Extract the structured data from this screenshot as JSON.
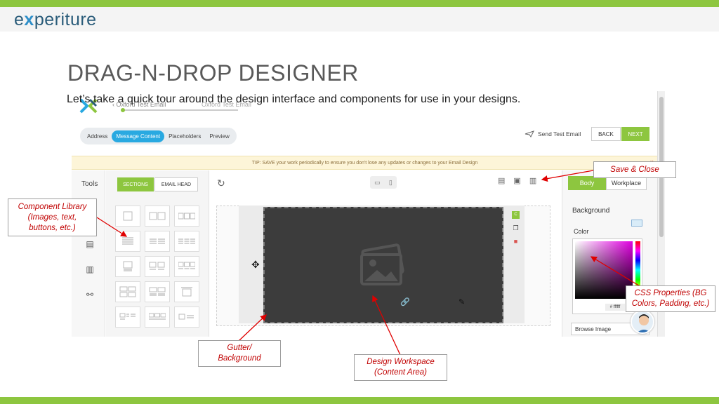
{
  "brand": {
    "logo_prefix": "e",
    "logo_x": "x",
    "logo_suffix": "periture",
    "accent": "#8dc63f",
    "blue": "#29a9e1"
  },
  "slide": {
    "title": "DRAG-N-DROP DESIGNER",
    "subtitle": "Let’s take a quick tour around the design interface and components for use in your designs."
  },
  "app": {
    "doc_name": "Oxford Test Email",
    "doc_name_secondary": "Oxford Test Email",
    "step_tabs": [
      "Address",
      "Message Content",
      "Placeholders",
      "Preview"
    ],
    "active_step": "Message Content",
    "send_test": "Send Test Email",
    "back": "BACK",
    "next": "NEXT",
    "tip": "TIP: SAVE your work periodically to ensure you don't lose any updates or changes to your Email Design",
    "tip_close": "×",
    "tools_label": "Tools",
    "lib_tabs": {
      "sections": "SECTIONS",
      "email_head": "EMAIL HEAD"
    },
    "props_tabs": {
      "body": "Body",
      "workplace": "Workplace"
    },
    "background_label": "Background",
    "color_label": "Color",
    "hex_placeholder": "# ffffff",
    "browse_image": "Browse Image"
  },
  "callouts": {
    "save_close": "Save & Close",
    "component_library": "Component Library (Images, text, buttons, etc.)",
    "css_properties": "CSS Properties (BG Colors, Padding, etc.)",
    "gutter": "Gutter/ Background",
    "design_workspace": "Design Workspace (Content Area)"
  },
  "icons": [
    "refresh-icon",
    "desktop-icon",
    "mobile-icon",
    "save-icon",
    "move-icon",
    "link-icon",
    "edit-icon",
    "delete-icon",
    "copy-icon",
    "css-icon",
    "send-icon",
    "image-placeholder-icon"
  ]
}
